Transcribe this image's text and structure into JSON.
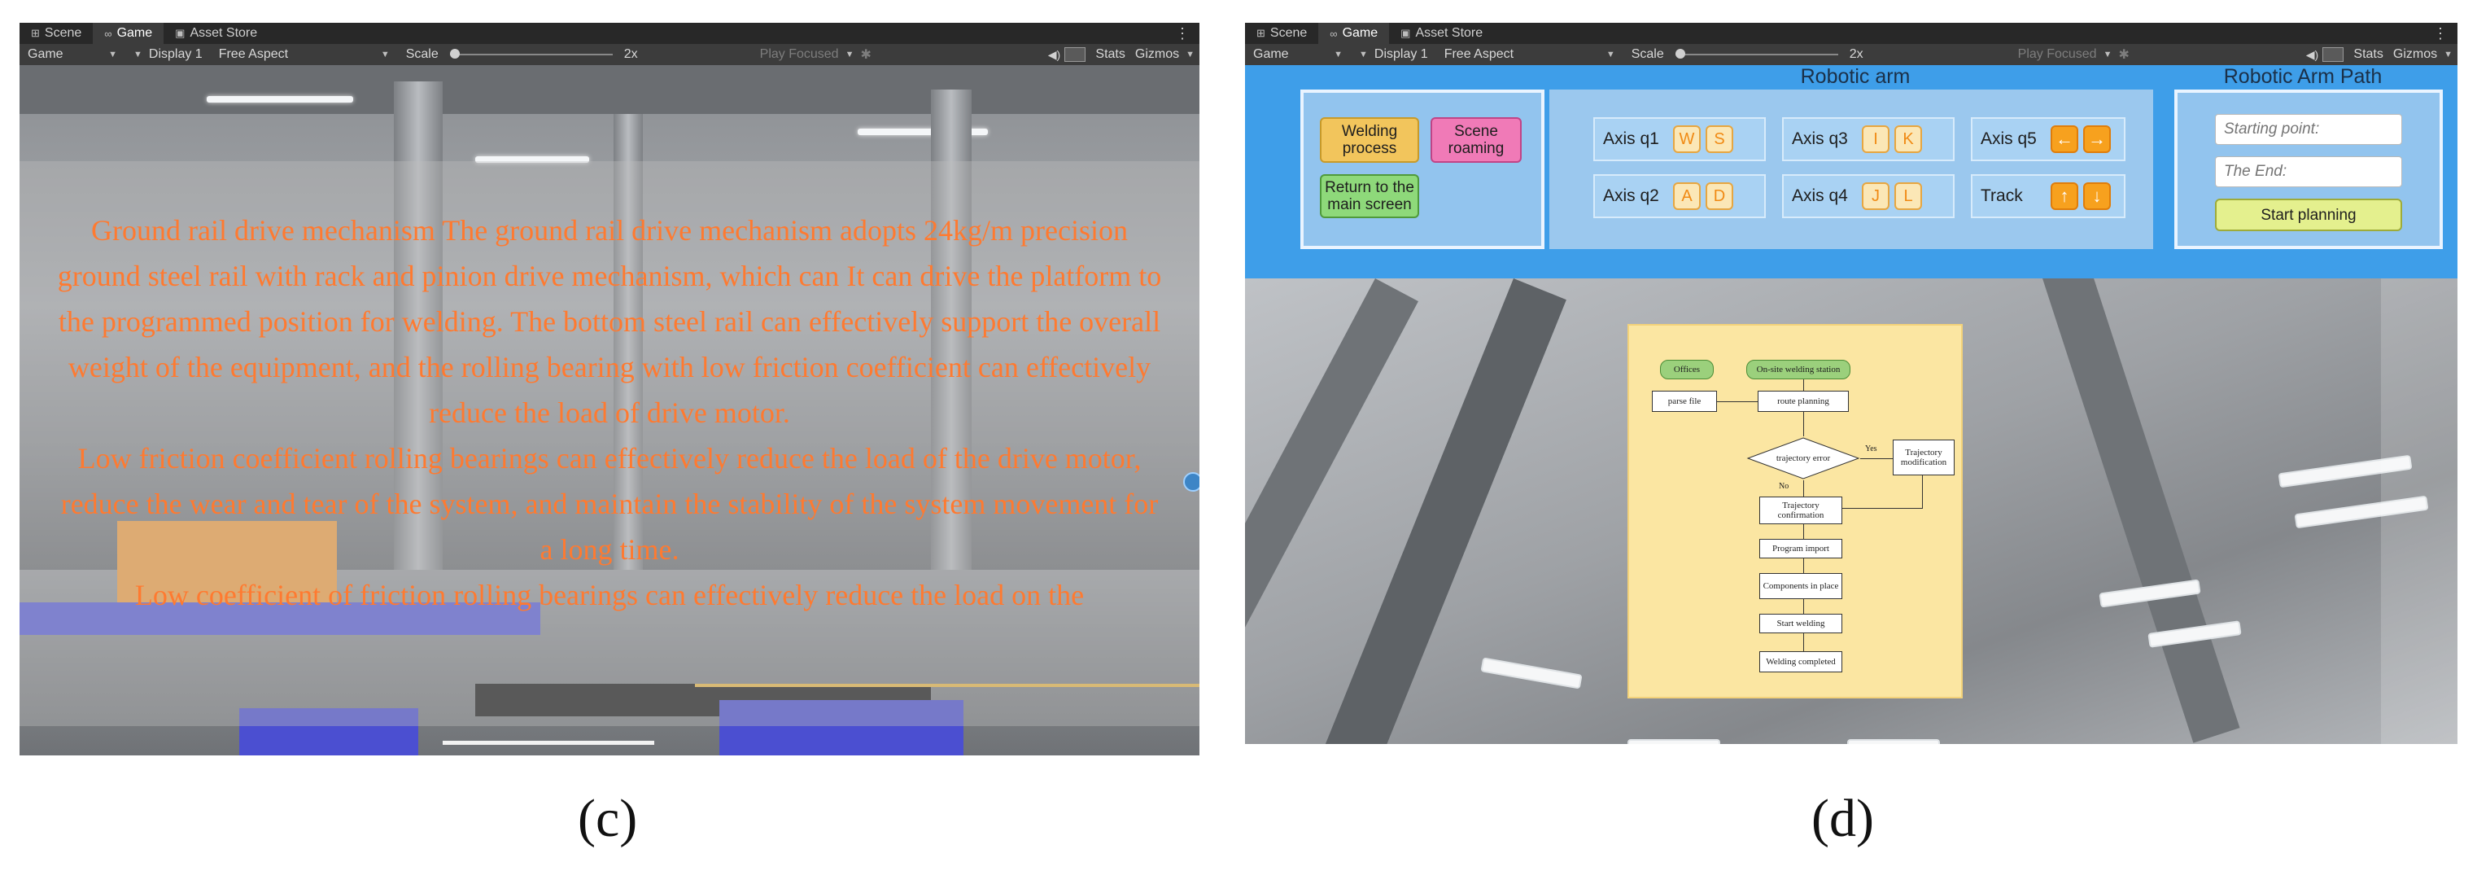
{
  "editor_tabs": [
    {
      "icon": "grid-icon",
      "label": "Scene"
    },
    {
      "icon": "gamepad-icon",
      "label": "Game"
    },
    {
      "icon": "lock-icon",
      "label": "Asset Store"
    }
  ],
  "toolbar": {
    "game_label": "Game",
    "display_label": "Display 1",
    "aspect_label": "Free Aspect",
    "scale_label": "Scale",
    "scale_value": "2x",
    "play_focused_label": "Play Focused",
    "stats_label": "Stats",
    "gizmos_label": "Gizmos"
  },
  "panel_c": {
    "caption": "(c)",
    "paragraphs": [
      "Ground rail drive mechanism The ground rail drive mechanism adopts 24kg/m precision ground steel rail with rack and pinion drive mechanism, which can It can drive the platform to the programmed position for welding. The bottom steel rail can effectively support the overall weight of the equipment, and the rolling bearing with low friction coefficient can effectively reduce the load of drive motor.",
      "Low friction coefficient rolling bearings can effectively reduce the load of the drive motor, reduce the wear and tear of the system, and maintain the stability of the system movement for a long time.",
      "Low coefficient of friction rolling bearings can effectively reduce the load on the"
    ]
  },
  "panel_d": {
    "caption": "(d)",
    "robotic_arm_title": "Robotic arm",
    "robotic_arm_path_title": "Robotic Arm Path",
    "buttons": {
      "welding_process": "Welding process",
      "scene_roaming": "Scene roaming",
      "return_main": "Return to the main screen",
      "start_planning": "Start planning"
    },
    "axes": [
      {
        "label": "Axis q1",
        "keys": [
          "W",
          "S"
        ]
      },
      {
        "label": "Axis q3",
        "keys": [
          "I",
          "K"
        ]
      },
      {
        "label": "Axis q5",
        "keys": [
          "←",
          "→"
        ]
      },
      {
        "label": "Axis q2",
        "keys": [
          "A",
          "D"
        ]
      },
      {
        "label": "Axis q4",
        "keys": [
          "J",
          "L"
        ]
      },
      {
        "label": "Track",
        "keys": [
          "↑",
          "↓"
        ]
      }
    ],
    "inputs": {
      "start_placeholder": "Starting point:",
      "end_placeholder": "The End:"
    },
    "flowchart": {
      "offices": "Offices",
      "onsite": "On-site welding station",
      "parse_file": "parse file",
      "route_planning": "route planning",
      "trajectory_error": "trajectory error",
      "yes": "Yes",
      "no": "No",
      "trajectory_modification": "Trajectory modification",
      "trajectory_confirmation": "Trajectory confirmation",
      "program_import": "Program import",
      "components_in_place": "Components in place",
      "start_welding": "Start welding",
      "welding_completed": "Welding completed"
    }
  },
  "colors": {
    "editor_bg": "#282828",
    "overlay_text": "#ff7a30",
    "ui_header_blue": "#3e9ee9",
    "key_orange": "#f7a11e"
  }
}
